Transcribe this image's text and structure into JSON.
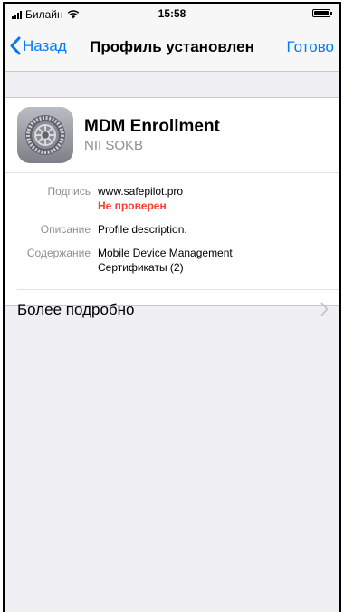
{
  "status_bar": {
    "carrier": "Билайн",
    "time": "15:58"
  },
  "nav": {
    "back_label": "Назад",
    "title": "Профиль установлен",
    "done_label": "Готово"
  },
  "profile": {
    "name": "MDM Enrollment",
    "organization": "NII SOKB",
    "icon": "settings-gear-icon"
  },
  "details": {
    "signed_label": "Подпись",
    "signed_value": "www.safepilot.pro",
    "signed_status": "Не проверен",
    "description_label": "Описание",
    "description_value": "Profile description.",
    "contains_label": "Содержание",
    "contains_values": [
      "Mobile Device Management",
      "Сертификаты (2)"
    ]
  },
  "more_details": {
    "label": "Более подробно"
  },
  "colors": {
    "accent": "#007aff",
    "warning": "#ff3b30",
    "secondary_text": "#8e8e93",
    "background": "#efeff4"
  }
}
